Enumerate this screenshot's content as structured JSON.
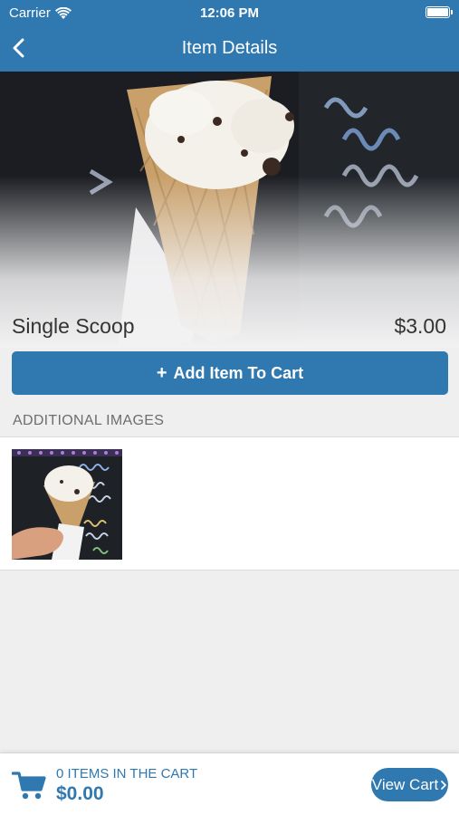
{
  "status_bar": {
    "carrier": "Carrier",
    "time": "12:06 PM"
  },
  "nav": {
    "title": "Item Details"
  },
  "item": {
    "name": "Single Scoop",
    "price": "$3.00"
  },
  "actions": {
    "add_to_cart_label": "Add Item To Cart"
  },
  "additional_images": {
    "header": "ADDITIONAL IMAGES"
  },
  "cart_bar": {
    "items_count_text": "0 ITEMS IN THE CART",
    "total": "$0.00",
    "view_cart_label": "View Cart"
  },
  "colors": {
    "primary": "#2f78b0",
    "background": "#efeff0"
  }
}
